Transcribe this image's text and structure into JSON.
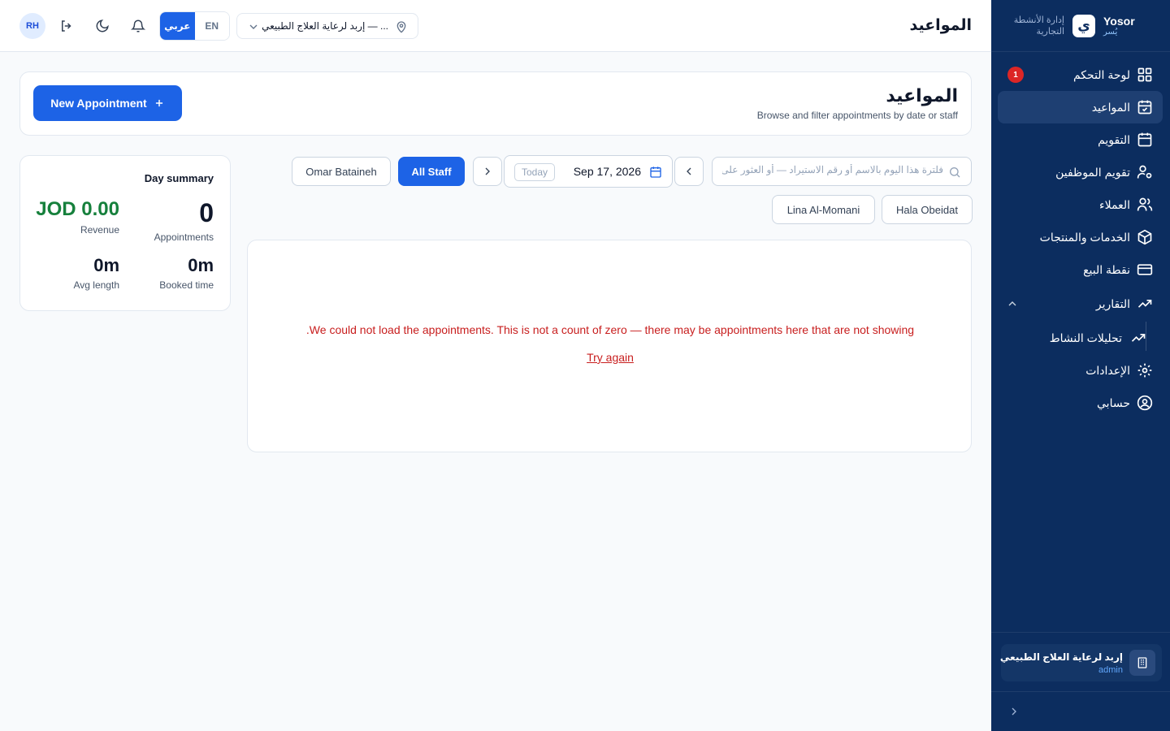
{
  "brand": {
    "name": "Yosor",
    "sub": "يُسر",
    "tagline": "إدارة الأنشطة التجارية"
  },
  "sidebar": {
    "items": [
      {
        "label": "لوحة التحكم",
        "badge": "1"
      },
      {
        "label": "المواعيد"
      },
      {
        "label": "التقويم"
      },
      {
        "label": "تقويم الموظفين"
      },
      {
        "label": "العملاء"
      },
      {
        "label": "الخدمات والمنتجات"
      },
      {
        "label": "نقطة البيع"
      },
      {
        "label": "التقارير"
      },
      {
        "label": "تحليلات النشاط"
      },
      {
        "label": "الإعدادات"
      },
      {
        "label": "حسابي"
      }
    ],
    "org": {
      "name": "إربد لرعاية العلاج الطبيعي",
      "role": "admin"
    }
  },
  "header": {
    "title": "المواعيد",
    "avatar": "RH",
    "lang": {
      "ar": "عربي",
      "en": "EN"
    },
    "branch": "إربد لرعاية العلاج الطبيعي — ..."
  },
  "page": {
    "title": "المواعيد",
    "subtitle": "Browse and filter appointments by date or staff",
    "new_button": "New Appointment"
  },
  "summary": {
    "title": "Day summary",
    "appointments_value": "0",
    "appointments_label": "Appointments",
    "revenue_value": "JOD 0.00",
    "revenue_label": "Revenue",
    "booked_value": "0m",
    "booked_label": "Booked time",
    "avg_value": "0m",
    "avg_label": "Avg length"
  },
  "filters": {
    "search_placeholder": "فلترة هذا اليوم بالاسم أو رقم الاستيراد — أو العثور على أ",
    "date": "Sep 17, 2026",
    "today": "Today",
    "staff": [
      "All Staff",
      "Omar Bataineh",
      "Hala Obeidat",
      "Lina Al-Momani"
    ]
  },
  "error": {
    "message": ".We could not load the appointments. This is not a count of zero — there may be appointments here that are not showing",
    "retry": "Try again"
  },
  "colors": {
    "sidebar": "#0c2d5f",
    "accent": "#1d63e6",
    "error": "#c81e1e",
    "revenue": "#16803c"
  }
}
